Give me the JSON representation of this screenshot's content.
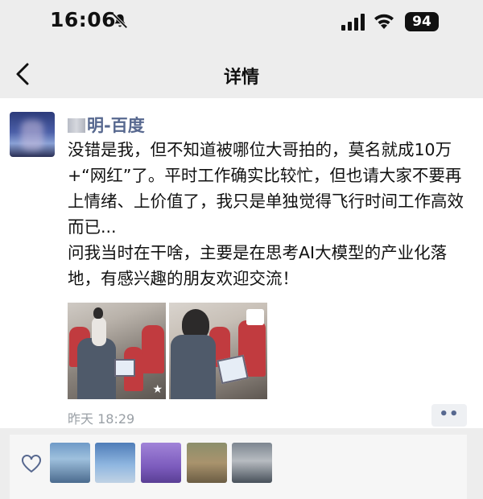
{
  "status_bar": {
    "time": "16:06",
    "battery": "94"
  },
  "nav": {
    "title": "详情"
  },
  "post": {
    "author_visible": "明-百度",
    "content": "没错是我，但不知道被哪位大哥拍的，莫名就成10万+“网红”了。平时工作确实比较忙，但也请大家不要再上情绪、上价值了，我只是单独觉得飞行时间工作高效而已...\n问我当时在干啥，主要是在思考AI大模型的产业化落地，有感兴趣的朋友欢迎交流！",
    "timestamp": "昨天 18:29",
    "more_label": "••"
  },
  "colors": {
    "author_name": "#57688f",
    "page_bg": "#ededed",
    "likes_bg": "#f6f6f6"
  },
  "icons": [
    "muted-bell-icon",
    "signal-icon",
    "wifi-icon",
    "back-chevron-icon",
    "heart-icon",
    "star-icon"
  ]
}
